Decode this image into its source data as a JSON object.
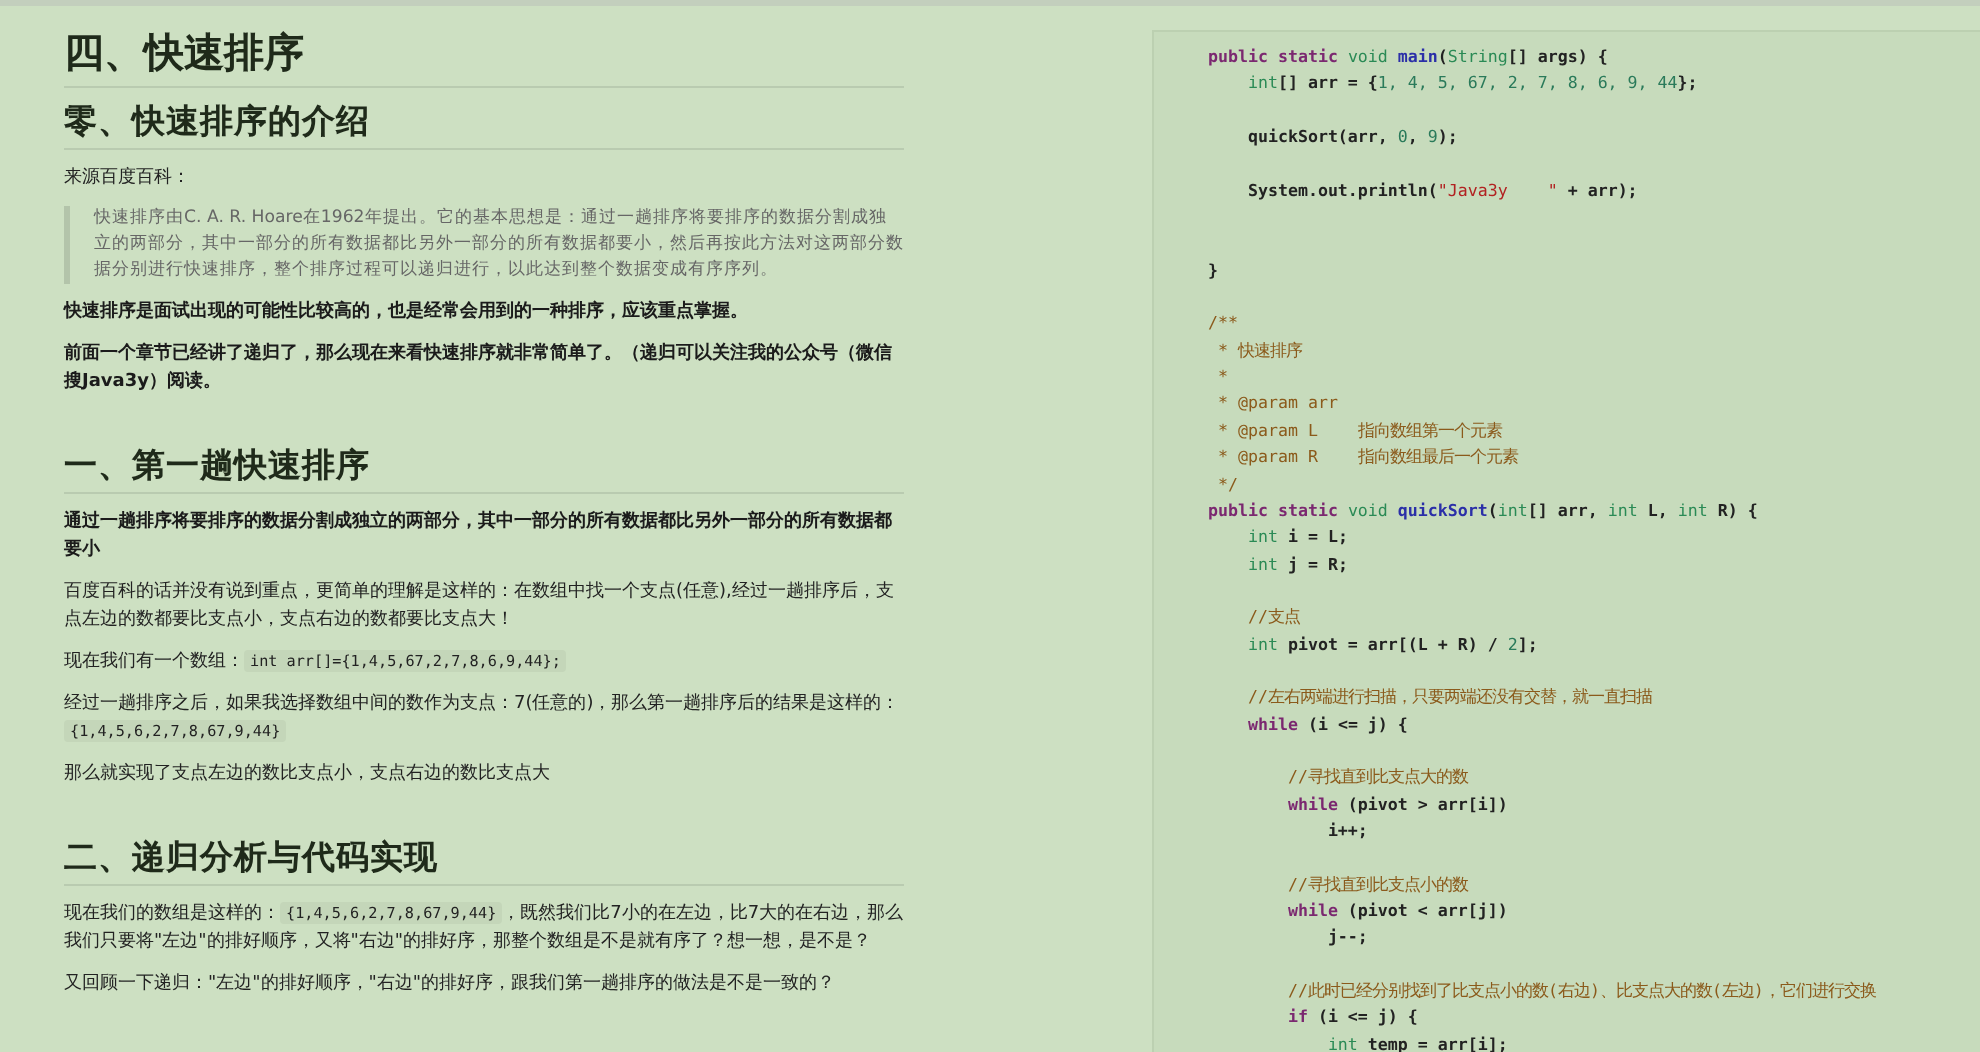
{
  "article": {
    "blocks": [
      {
        "kind": "h1",
        "text": "四、快速排序"
      },
      {
        "kind": "h2",
        "text": "零、快速排序的介绍"
      },
      {
        "kind": "p",
        "bold": false,
        "parts": [
          {
            "kind": "text",
            "text": "来源百度百科："
          }
        ]
      },
      {
        "kind": "quote",
        "text": "快速排序由C. A. R. Hoare在1962年提出。它的基本思想是：通过一趟排序将要排序的数据分割成独立的两部分，其中一部分的所有数据都比另外一部分的所有数据都要小，然后再按此方法对这两部分数据分别进行快速排序，整个排序过程可以递归进行，以此达到整个数据变成有序序列。"
      },
      {
        "kind": "p",
        "bold": true,
        "parts": [
          {
            "kind": "text",
            "text": "快速排序是面试出现的可能性比较高的，也是经常会用到的一种排序，应该重点掌握。"
          }
        ]
      },
      {
        "kind": "p",
        "bold": true,
        "parts": [
          {
            "kind": "text",
            "text": "前面一个章节已经讲了递归了，那么现在来看快速排序就非常简单了。（递归可以关注我的公众号（微信搜Java3y）阅读。"
          }
        ]
      },
      {
        "kind": "h2",
        "text": "一、第一趟快速排序"
      },
      {
        "kind": "p",
        "bold": true,
        "parts": [
          {
            "kind": "text",
            "text": "通过一趟排序将要排序的数据分割成独立的两部分，其中一部分的所有数据都比另外一部分的所有数据都要小"
          }
        ]
      },
      {
        "kind": "p",
        "bold": false,
        "parts": [
          {
            "kind": "text",
            "text": "百度百科的话并没有说到重点，更简单的理解是这样的：在数组中找一个支点(任意),经过一趟排序后，支点左边的数都要比支点小，支点右边的数都要比支点大！"
          }
        ]
      },
      {
        "kind": "p",
        "bold": false,
        "parts": [
          {
            "kind": "text",
            "text": "现在我们有一个数组："
          },
          {
            "kind": "code",
            "text": "int arr[]={1,4,5,67,2,7,8,6,9,44};"
          }
        ]
      },
      {
        "kind": "p",
        "bold": false,
        "parts": [
          {
            "kind": "text",
            "text": "经过一趟排序之后，如果我选择数组中间的数作为支点：7(任意的)，那么第一趟排序后的结果是这样的："
          },
          {
            "kind": "code",
            "text": "{1,4,5,6,2,7,8,67,9,44}"
          }
        ]
      },
      {
        "kind": "p",
        "bold": false,
        "parts": [
          {
            "kind": "text",
            "text": "那么就实现了支点左边的数比支点小，支点右边的数比支点大"
          }
        ]
      },
      {
        "kind": "h2",
        "text": "二、递归分析与代码实现"
      },
      {
        "kind": "p",
        "bold": false,
        "parts": [
          {
            "kind": "text",
            "text": "现在我们的数组是这样的："
          },
          {
            "kind": "code",
            "text": "{1,4,5,6,2,7,8,67,9,44}"
          },
          {
            "kind": "text",
            "text": "，既然我们比7小的在左边，比7大的在右边，那么我们只要将\"左边\"的排好顺序，又将\"右边\"的排好序，那整个数组是不是就有序了？想一想，是不是？"
          }
        ]
      },
      {
        "kind": "p",
        "bold": false,
        "parts": [
          {
            "kind": "text",
            "text": "又回顾一下递归：\"左边\"的排好顺序，\"右边\"的排好序，跟我们第一趟排序的做法是不是一致的？"
          }
        ]
      }
    ]
  },
  "code_panel": {
    "lines": [
      {
        "tokens": [
          {
            "text": "public ",
            "kind": "kw"
          },
          {
            "text": "static ",
            "kind": "kw"
          },
          {
            "text": "void ",
            "kind": "ty"
          },
          {
            "text": "main",
            "kind": "fn"
          },
          {
            "text": "(",
            "kind": "p"
          },
          {
            "text": "String",
            "kind": "ty"
          },
          {
            "text": "[] args) {",
            "kind": "p"
          }
        ]
      },
      {
        "tokens": [
          {
            "text": "    int",
            "kind": "ty"
          },
          {
            "text": "[] arr = {",
            "kind": "p"
          },
          {
            "text": "1, 4, 5, 67, 2, 7, 8, 6, 9, 44",
            "kind": "n"
          },
          {
            "text": "};",
            "kind": "p"
          }
        ]
      },
      {
        "blank_before": true,
        "tokens": [
          {
            "text": "    quickSort(arr, ",
            "kind": "p"
          },
          {
            "text": "0",
            "kind": "n"
          },
          {
            "text": ", ",
            "kind": "p"
          },
          {
            "text": "9",
            "kind": "n"
          },
          {
            "text": ");",
            "kind": "p"
          }
        ]
      },
      {
        "blank_before": true,
        "tokens": [
          {
            "text": "    System.out.println(",
            "kind": "p"
          },
          {
            "text": "\"Java3y    \"",
            "kind": "s"
          },
          {
            "text": " + arr);",
            "kind": "p"
          }
        ]
      },
      {
        "blank_before": true,
        "extra_blank": true,
        "tokens": [
          {
            "text": "}",
            "kind": "p"
          }
        ]
      },
      {
        "blank_before": true,
        "tokens": [
          {
            "text": "/**",
            "kind": "c"
          }
        ]
      },
      {
        "tokens": [
          {
            "text": " * 快速排序",
            "kind": "c"
          }
        ]
      },
      {
        "tokens": [
          {
            "text": " *",
            "kind": "c"
          }
        ]
      },
      {
        "tokens": [
          {
            "text": " * @param arr",
            "kind": "c"
          }
        ]
      },
      {
        "tokens": [
          {
            "text": " * @param L    指向数组第一个元素",
            "kind": "c"
          }
        ]
      },
      {
        "tokens": [
          {
            "text": " * @param R    指向数组最后一个元素",
            "kind": "c"
          }
        ]
      },
      {
        "tokens": [
          {
            "text": " */",
            "kind": "c"
          }
        ]
      },
      {
        "tokens": [
          {
            "text": "public ",
            "kind": "kw"
          },
          {
            "text": "static ",
            "kind": "kw"
          },
          {
            "text": "void ",
            "kind": "ty"
          },
          {
            "text": "quickSort",
            "kind": "fn"
          },
          {
            "text": "(",
            "kind": "p"
          },
          {
            "text": "int",
            "kind": "ty"
          },
          {
            "text": "[] arr, ",
            "kind": "p"
          },
          {
            "text": "int",
            "kind": "ty"
          },
          {
            "text": " L, ",
            "kind": "p"
          },
          {
            "text": "int",
            "kind": "ty"
          },
          {
            "text": " R) {",
            "kind": "p"
          }
        ]
      },
      {
        "tokens": [
          {
            "text": "    int",
            "kind": "ty"
          },
          {
            "text": " i = L;",
            "kind": "p"
          }
        ]
      },
      {
        "tokens": [
          {
            "text": "    int",
            "kind": "ty"
          },
          {
            "text": " j = R;",
            "kind": "p"
          }
        ]
      },
      {
        "blank_before": true,
        "tokens": [
          {
            "text": "    //支点",
            "kind": "c"
          }
        ]
      },
      {
        "tokens": [
          {
            "text": "    int",
            "kind": "ty"
          },
          {
            "text": " pivot = arr[(L + R) / ",
            "kind": "p"
          },
          {
            "text": "2",
            "kind": "n"
          },
          {
            "text": "];",
            "kind": "p"
          }
        ]
      },
      {
        "blank_before": true,
        "tokens": [
          {
            "text": "    //左右两端进行扫描，只要两端还没有交替，就一直扫描",
            "kind": "c"
          }
        ]
      },
      {
        "tokens": [
          {
            "text": "    while",
            "kind": "kw"
          },
          {
            "text": " (i <= j) {",
            "kind": "p"
          }
        ]
      },
      {
        "blank_before": true,
        "tokens": [
          {
            "text": "        //寻找直到比支点大的数",
            "kind": "c"
          }
        ]
      },
      {
        "tokens": [
          {
            "text": "        while",
            "kind": "kw"
          },
          {
            "text": " (pivot > arr[i])",
            "kind": "p"
          }
        ]
      },
      {
        "tokens": [
          {
            "text": "            i++;",
            "kind": "p"
          }
        ]
      },
      {
        "blank_before": true,
        "tokens": [
          {
            "text": "        //寻找直到比支点小的数",
            "kind": "c"
          }
        ]
      },
      {
        "tokens": [
          {
            "text": "        while",
            "kind": "kw"
          },
          {
            "text": " (pivot < arr[j])",
            "kind": "p"
          }
        ]
      },
      {
        "tokens": [
          {
            "text": "            j--;",
            "kind": "p"
          }
        ]
      },
      {
        "blank_before": true,
        "tokens": [
          {
            "text": "        //此时已经分别找到了比支点小的数(右边)、比支点大的数(左边)，它们进行交换",
            "kind": "c"
          }
        ]
      },
      {
        "tokens": [
          {
            "text": "        if",
            "kind": "kw"
          },
          {
            "text": " (i <= j) {",
            "kind": "p"
          }
        ]
      },
      {
        "tokens": [
          {
            "text": "            int",
            "kind": "ty"
          },
          {
            "text": " temp = arr[i];",
            "kind": "p"
          }
        ]
      }
    ]
  }
}
